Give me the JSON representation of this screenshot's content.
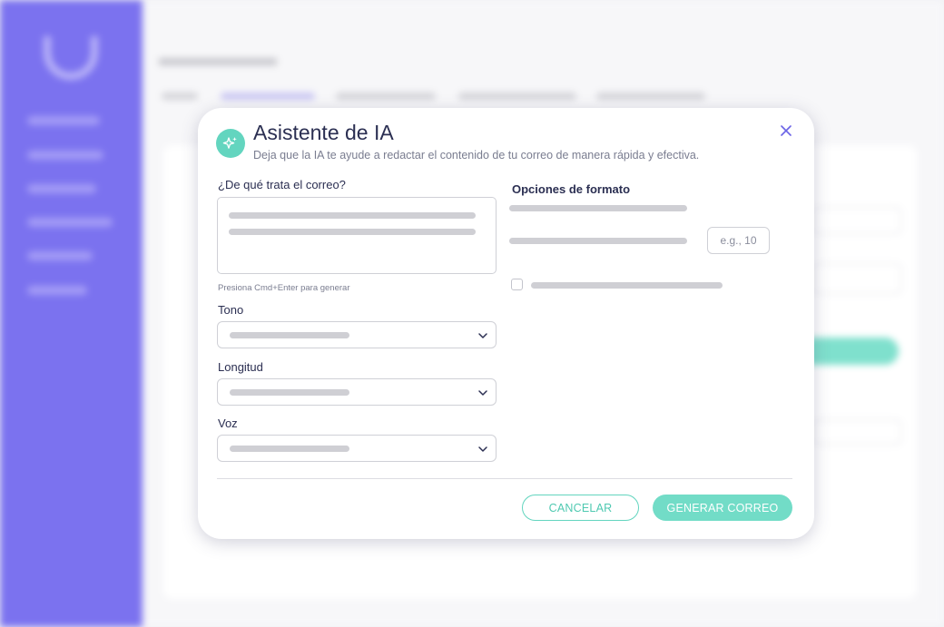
{
  "modal": {
    "title": "Asistente de IA",
    "subtitle": "Deja que la IA te ayude a redactar el contenido de tu correo de manera rápida y efectiva.",
    "icon": "sparkle-icon",
    "close_icon": "close-icon"
  },
  "form": {
    "topic_label": "¿De qué trata el correo?",
    "topic_hint": "Presiona Cmd+Enter para generar",
    "tone_label": "Tono",
    "length_label": "Longitud",
    "voice_label": "Voz"
  },
  "format": {
    "title": "Opciones de formato",
    "number_placeholder": "e.g., 10"
  },
  "buttons": {
    "cancel": "CANCELAR",
    "generate": "GENERAR CORREO"
  },
  "colors": {
    "accent": "#63d5bf",
    "sidebar": "#7b72ef",
    "title_text": "#2b2f52"
  }
}
